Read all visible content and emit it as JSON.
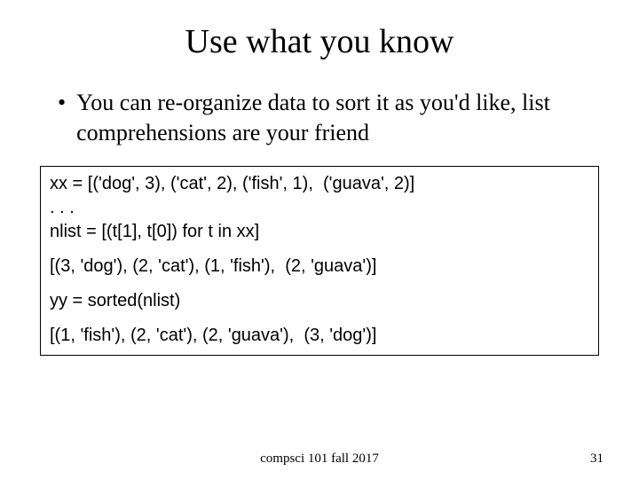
{
  "title": "Use what you know",
  "bullet": {
    "marker": "•",
    "text": "You can re-organize data to sort it as you'd like, list comprehensions are your friend"
  },
  "code": {
    "line1": "xx = [('dog', 3), ('cat', 2), ('fish', 1),  ('guava', 2)]",
    "line2": ". . .",
    "line3": "nlist = [(t[1], t[0]) for t in xx]",
    "line4": "[(3, 'dog'), (2, 'cat'), (1, 'fish'),  (2, 'guava')]",
    "line5": "yy = sorted(nlist)",
    "line6": "[(1, 'fish'), (2, 'cat'), (2, 'guava'),  (3, 'dog')]"
  },
  "footer": {
    "center": "compsci 101 fall 2017",
    "page": "31"
  }
}
